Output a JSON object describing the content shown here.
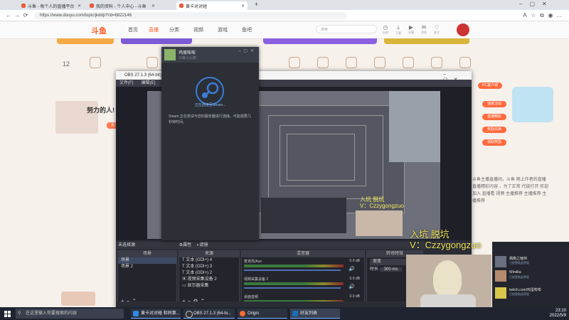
{
  "browser": {
    "tabs": [
      {
        "label": "斗鱼 - 每个人的直播平台"
      },
      {
        "label": "我的资料 - 个人中心 - 斗鱼"
      },
      {
        "label": "黄卡对对碰"
      }
    ],
    "new_tab": "+",
    "url": "https://www.douyu.com/topic/jkddp?rid=6822146"
  },
  "site": {
    "logo": "斗鱼",
    "nav": [
      "首页",
      "直播",
      "分类",
      "视频",
      "游戏",
      "鱼吧"
    ],
    "search_placeholder": "搜索",
    "top_icons": [
      "历史",
      "下载",
      "开播",
      "消息",
      "关注"
    ],
    "stat": "12",
    "anchor_name": "努力的人!",
    "anchor_button": "关注",
    "promo_badges": [
      "PC客户端",
      "独家活动",
      "直播精彩",
      "奖励兑换",
      "领取奖励"
    ],
    "side_text": "斗鱼主播直播间，斗鱼 网上作者的直播 直播精彩内容 ，为了正常 代链打开 欢迎加入 直播看 视频 主播推荐 主播推荐 主播推荐"
  },
  "obs": {
    "title": "OBS 27.1.3 (64-bit)",
    "menu": [
      "文件(F)",
      "编辑(E)",
      "视图"
    ],
    "scene_bar": "未选择源",
    "scene_bar_buttons": [
      "属性",
      "滤镜"
    ],
    "docks": {
      "scenes": {
        "title": "场景",
        "items": [
          "场景",
          "场景 2"
        ]
      },
      "sources": {
        "title": "来源",
        "items": [
          "文本 (GDI+) 4",
          "文本 (GDI+) 3",
          "文本 (GDI+) 2",
          "视频采集设备 2",
          "显示器采集"
        ]
      },
      "mixer": {
        "title": "混音器",
        "channels": [
          {
            "name": "麦克风/Aux",
            "db": "0.0 dB"
          },
          {
            "name": "视频采集设备 2",
            "db": "0.0 dB"
          },
          {
            "name": "桌面音频",
            "db": "0.0 dB"
          }
        ]
      },
      "transitions": {
        "title": "转场特效",
        "item": "渐变",
        "duration_label": "时长",
        "duration": "300 ms"
      }
    },
    "status": "LIVE: 00:00:00   REC: 00:00:00"
  },
  "steam": {
    "name": "鸡蛋嘭嘭",
    "status": "三级小火箭",
    "connecting": "正在连接至Steam...",
    "message": "Steam 正在尝试与您的服务器进行连接。可能需要几秒钟时间。"
  },
  "overlay": {
    "line1": "入坑 脱坑",
    "line2": "V：Czzygongzuo"
  },
  "friends": [
    {
      "name": "偶像之锤帅",
      "status": "已经登陆此界面"
    },
    {
      "name": "Windka",
      "status": "已经登陆此界面"
    },
    {
      "name": "twitch.com/鸡蛋嘭嘭",
      "status": "已经登陆此界面"
    }
  ],
  "taskbar": {
    "search_placeholder": "在这里输入你要搜索的内容",
    "apps": [
      "黄卡对对碰 和同事...",
      "OBS 27.1.3 (64-bi...",
      "Origin",
      "好友列表"
    ],
    "time": "23:10",
    "date": "2022/5/9"
  },
  "colors": {
    "accent": "#ff5d23",
    "overlay_text": "#f2e85a",
    "obs_bg": "#2b2d36",
    "steam_blue": "#3b7dd8"
  }
}
